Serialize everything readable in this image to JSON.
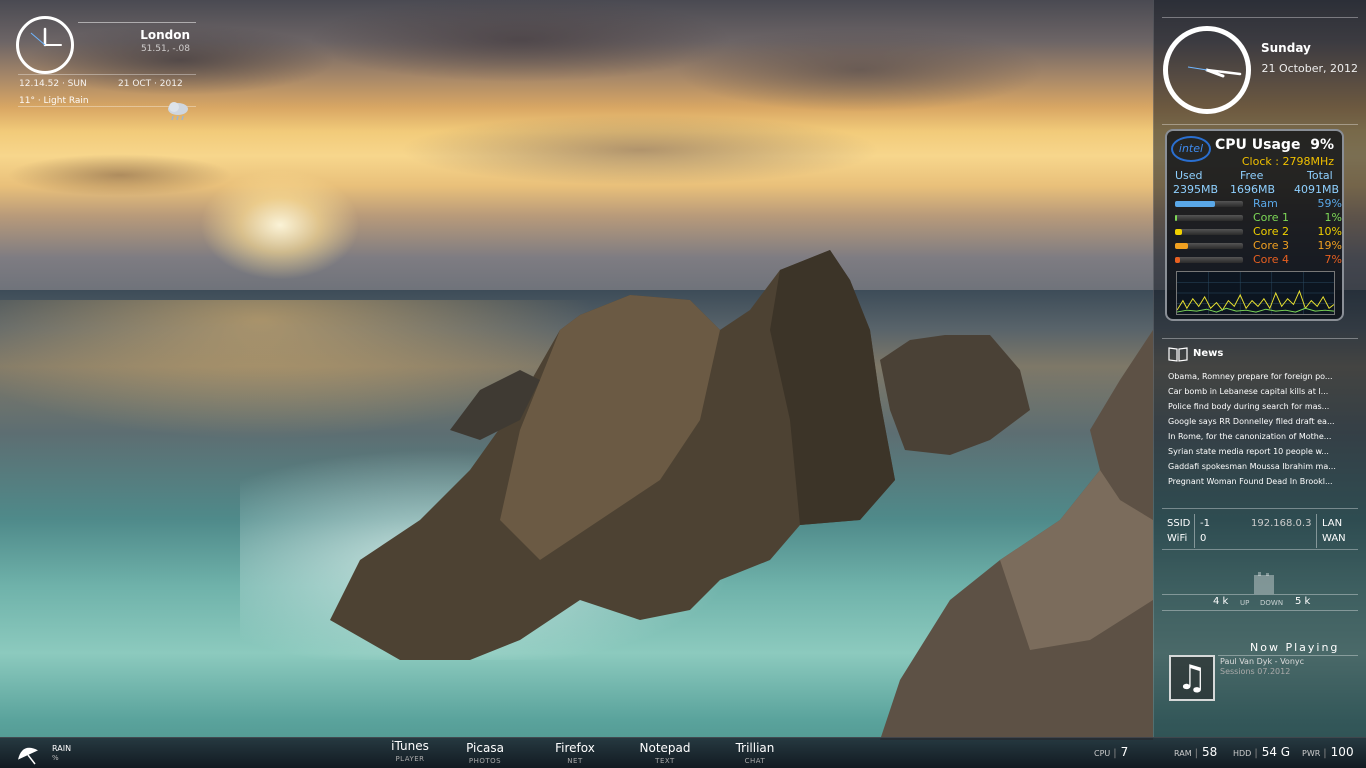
{
  "weather_widget": {
    "city": "London",
    "coords": "51.51, -.08",
    "time": "12.14.52 · SUN",
    "date": "21 OCT · 2012",
    "condition": "11° · Light Rain",
    "icon": "rain-cloud-icon"
  },
  "sidebar": {
    "clock": {
      "day": "Sunday",
      "date": "21 October, 2012"
    },
    "cpu": {
      "brand": "intel",
      "title": "CPU Usage",
      "percent": "9%",
      "clock": "Clock : 2798MHz",
      "memory": {
        "headers": [
          "Used",
          "Free",
          "Total"
        ],
        "values": [
          "2395MB",
          "1696MB",
          "4091MB"
        ]
      },
      "bars": [
        {
          "label": "Ram",
          "percent": "59%",
          "level": 0.59,
          "color": "#5aa8e8"
        },
        {
          "label": "Core 1",
          "percent": "1%",
          "level": 0.01,
          "color": "#7ed957"
        },
        {
          "label": "Core 2",
          "percent": "10%",
          "level": 0.1,
          "color": "#f0d000"
        },
        {
          "label": "Core 3",
          "percent": "19%",
          "level": 0.19,
          "color": "#f0a020"
        },
        {
          "label": "Core 4",
          "percent": "7%",
          "level": 0.07,
          "color": "#e86020"
        }
      ]
    },
    "news": {
      "title": "News",
      "items": [
        "Obama, Romney prepare for foreign po...",
        "Car bomb in Lebanese capital kills at l...",
        "Police find body during search for mas...",
        "Google says RR Donnelley filed draft ea...",
        "In Rome, for the canonization of Mothe...",
        "Syrian state media report 10 people w...",
        "Gaddafi spokesman Moussa Ibrahim ma...",
        "Pregnant Woman Found Dead In Brookl..."
      ]
    },
    "network": {
      "ssid_label": "SSID",
      "ssid_value": "-1",
      "wifi_label": "WiFi",
      "wifi_value": "0",
      "ip": "192.168.0.3",
      "lan": "LAN",
      "wan": "WAN",
      "up_speed": "4 k",
      "up_label": "UP",
      "down_label": "DOWN",
      "down_speed": "5 k"
    },
    "now_playing": {
      "title": "Now Playing",
      "artist": "Paul Van Dyk - Vonyc",
      "album": "Sessions 07.2012",
      "icon": "music-note-icon"
    }
  },
  "taskbar": {
    "weather_label": "RAIN",
    "weather_sub": "%",
    "launchers": [
      {
        "label": "iTunes",
        "sub": "PLAYER"
      },
      {
        "label": "Picasa",
        "sub": "PHOTOS"
      },
      {
        "label": "Firefox",
        "sub": "NET"
      },
      {
        "label": "Notepad",
        "sub": "TEXT"
      },
      {
        "label": "Trillian",
        "sub": "CHAT"
      }
    ],
    "stats": [
      {
        "key": "CPU",
        "value": "7"
      },
      {
        "key": "RAM",
        "value": "58"
      },
      {
        "key": "HDD",
        "value": "54 G"
      },
      {
        "key": "PWR",
        "value": "100"
      }
    ]
  },
  "colors": {
    "accent_cpu_clock": "#f0c000",
    "memory_text": "#8fd0ff"
  }
}
